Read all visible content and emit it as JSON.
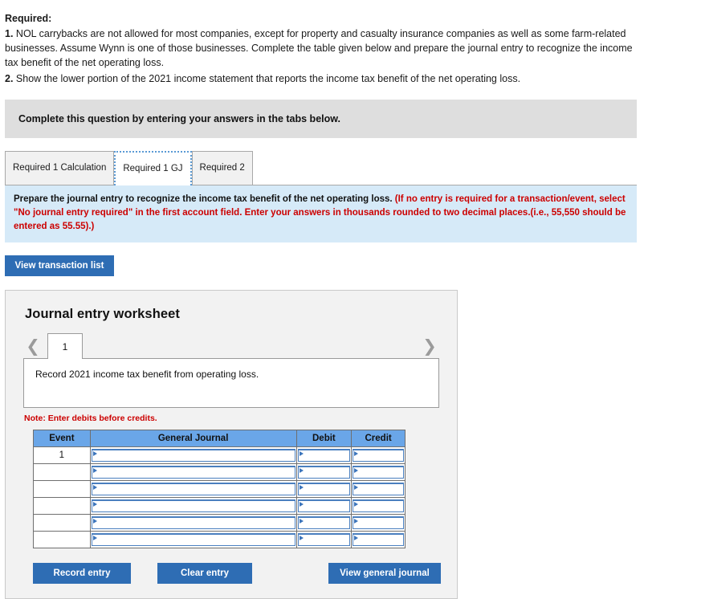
{
  "prompt": {
    "heading": "Required:",
    "item1_num": "1.",
    "item1_text": " NOL carrybacks are not allowed for most companies, except for property and casualty insurance companies as well as some farm-related businesses. Assume Wynn is one of those businesses. Complete the table given below and prepare the journal entry to recognize the income tax benefit of the net operating loss.",
    "item2_num": "2.",
    "item2_text": " Show the lower portion of the 2021 income statement that reports the income tax benefit of the net operating loss."
  },
  "banner": {
    "text": "Complete this question by entering your answers in the tabs below."
  },
  "tabs": [
    {
      "label": "Required 1 Calculation",
      "active": false
    },
    {
      "label": "Required 1 GJ",
      "active": true
    },
    {
      "label": "Required 2",
      "active": false
    }
  ],
  "instruction": {
    "black": "Prepare the journal entry to recognize the income tax benefit of the net operating loss. ",
    "red": "(If no entry is required for a transaction/event, select \"No journal entry required\" in the first account field. Enter your answers in thousands rounded to two decimal places.(i.e., 55,550 should be entered as 55.55).)"
  },
  "view_transaction_list_label": "View transaction list",
  "worksheet": {
    "title": "Journal entry worksheet",
    "prev_icon": "chevron-left-icon",
    "next_icon": "chevron-right-icon",
    "page_number": "1",
    "description": "Record 2021 income tax benefit from operating loss.",
    "note": "Note: Enter debits before credits.",
    "table": {
      "headers": [
        "Event",
        "General Journal",
        "Debit",
        "Credit"
      ],
      "rows": [
        {
          "event": "1",
          "general_journal": "",
          "debit": "",
          "credit": ""
        },
        {
          "event": "",
          "general_journal": "",
          "debit": "",
          "credit": ""
        },
        {
          "event": "",
          "general_journal": "",
          "debit": "",
          "credit": ""
        },
        {
          "event": "",
          "general_journal": "",
          "debit": "",
          "credit": ""
        },
        {
          "event": "",
          "general_journal": "",
          "debit": "",
          "credit": ""
        },
        {
          "event": "",
          "general_journal": "",
          "debit": "",
          "credit": ""
        }
      ]
    },
    "buttons": {
      "record": "Record entry",
      "clear": "Clear entry",
      "view_gj": "View general journal"
    }
  },
  "colors": {
    "button_blue": "#2e6db4",
    "table_header_blue": "#6aa6e8",
    "banner_gray": "#dedede",
    "instruction_blue": "#d6eaf8",
    "red_text": "#cc0000",
    "panel_gray": "#f2f2f2"
  }
}
